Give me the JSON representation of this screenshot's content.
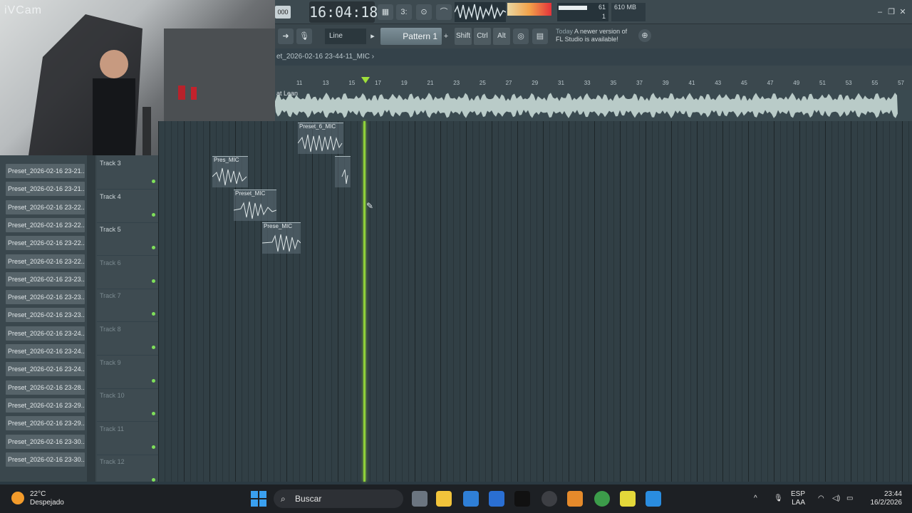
{
  "webcam": {
    "brand": "iVCam"
  },
  "topbar": {
    "tempo_label": "000",
    "time": "16:04:18",
    "cpu_value": "61",
    "cpu_sub": "1",
    "memory": "610 MB"
  },
  "toolbar": {
    "line_mode": "Line",
    "pattern": "Pattern 1",
    "pattern_add": "+",
    "shift": "Shift",
    "ctrl": "Ctrl",
    "alt": "Alt",
    "news_when": "Today",
    "news_text": "A newer version of FL Studio is available!"
  },
  "path": {
    "title": "et_2026-02-16 23-44-11_MIC",
    "arrow": "›"
  },
  "ruler": {
    "ticks": [
      "11",
      "13",
      "15",
      "17",
      "19",
      "21",
      "23",
      "25",
      "27",
      "29",
      "31",
      "33",
      "35",
      "37",
      "39",
      "41",
      "43",
      "45",
      "47",
      "49",
      "51",
      "53",
      "55",
      "57"
    ]
  },
  "audio_track": {
    "label": "at Lean"
  },
  "browser": {
    "items": [
      "Preset_2026-02-16 23-21...",
      "Preset_2026-02-16 23-21...",
      "Preset_2026-02-16 23-22...",
      "Preset_2026-02-16 23-22...",
      "Preset_2026-02-16 23-22...",
      "Preset_2026-02-16 23-22...",
      "Preset_2026-02-16 23-23...",
      "Preset_2026-02-16 23-23...",
      "Preset_2026-02-16 23-23...",
      "Preset_2026-02-16 23-24...",
      "Preset_2026-02-16 23-24...",
      "Preset_2026-02-16 23-24...",
      "Preset_2026-02-16 23-28...",
      "Preset_2026-02-16 23-29...",
      "Preset_2026-02-16 23-29...",
      "Preset_2026-02-16 23-30...",
      "Preset_2026-02-16 23-30..."
    ]
  },
  "tracks": [
    {
      "name": "Track 3",
      "dim": false
    },
    {
      "name": "Track 4",
      "dim": false
    },
    {
      "name": "Track 5",
      "dim": false
    },
    {
      "name": "Track 6",
      "dim": true
    },
    {
      "name": "Track 7",
      "dim": true
    },
    {
      "name": "Track 8",
      "dim": true
    },
    {
      "name": "Track 9",
      "dim": true
    },
    {
      "name": "Track 10",
      "dim": true
    },
    {
      "name": "Track 11",
      "dim": true
    },
    {
      "name": "Track 12",
      "dim": true
    }
  ],
  "clips": [
    {
      "title": "Preset_6_MIC"
    },
    {
      "title": "Pres_MIC"
    },
    {
      "title": ""
    },
    {
      "title": "Preset_MIC"
    },
    {
      "title": "Prese_MIC"
    }
  ],
  "taskbar": {
    "temperature": "22°C",
    "weather": "Despejado",
    "search": "Buscar",
    "lang": "ESP",
    "layout": "LAA",
    "clock_time": "23:44",
    "clock_date": "16/2/2026"
  },
  "colors": {
    "accent": "#8fd13a",
    "led": "#7fe05a",
    "panel": "#3e4b51"
  }
}
